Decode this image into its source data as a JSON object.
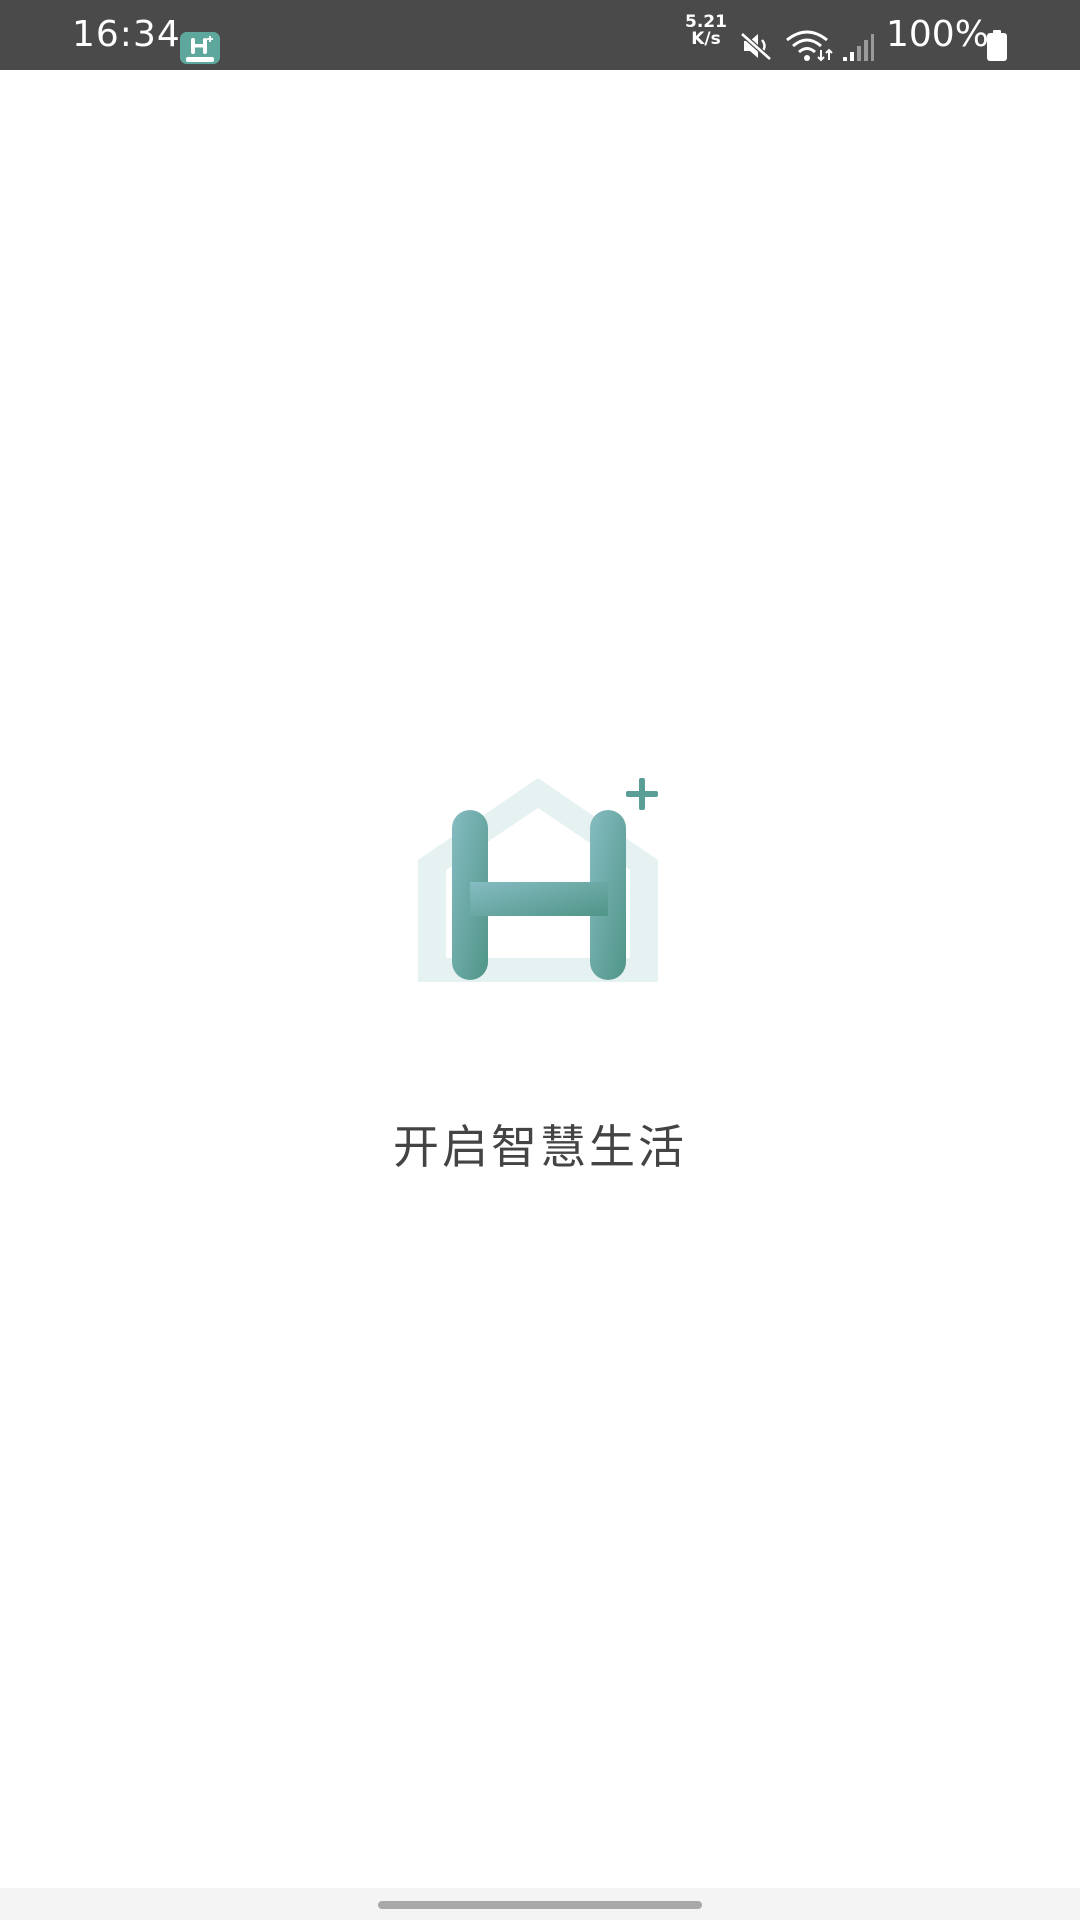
{
  "status_bar": {
    "time": "16:34",
    "network_speed_value": "5.21",
    "network_speed_unit": "K/s",
    "battery_percent": "100%",
    "icons": [
      "app-notification-icon",
      "mute-icon",
      "wifi-icon",
      "signal-icon",
      "battery-icon"
    ]
  },
  "splash": {
    "tagline": "开启智慧生活",
    "logo_icon": "house-h-plus-logo-icon"
  },
  "colors": {
    "status_bar_bg": "#4a4a4a",
    "brand_teal_light": "#86bcc2",
    "brand_teal_dark": "#4f9587",
    "house_outline": "#e6f2f1",
    "tagline_text": "#444444"
  }
}
